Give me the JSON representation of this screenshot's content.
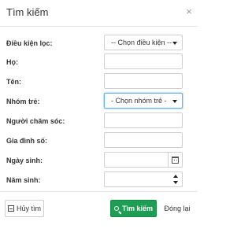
{
  "dialog": {
    "title": "Tìm kiếm",
    "close_glyph": "×"
  },
  "fields": {
    "filter_label": "Điều kiện lọc:",
    "filter_selected": "-- Chọn điều kiện --",
    "last_name_label": "Họ:",
    "first_name_label": "Tên:",
    "group_label": "Nhóm trẻ:",
    "group_selected": "- Chọn nhóm trẻ -",
    "caregiver_label": "Người chăm sóc:",
    "family_label": "Gia đình số:",
    "birthdate_label": "Ngày sinh:",
    "birthyear_label": "Năm sinh:"
  },
  "buttons": {
    "cancel": "Hủy tìm",
    "search": "Tìm kiếm",
    "reset": "Đóng lại"
  },
  "colors": {
    "search_button": "#1f9d55",
    "focus_border": "#66afe9"
  },
  "icons": {
    "close": "close-icon",
    "calendar": "calendar-icon",
    "search": "search-icon",
    "cancel": "cancel-icon"
  }
}
